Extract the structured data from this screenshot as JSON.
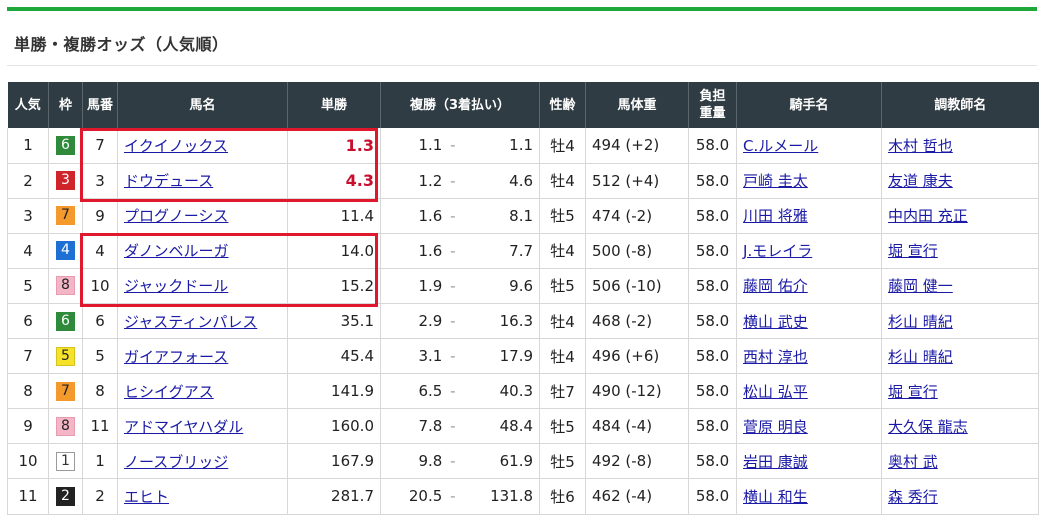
{
  "section": {
    "title": "単勝・複勝オッズ（人気順）"
  },
  "columns": {
    "pop": "人気",
    "frame": "枠",
    "num": "馬番",
    "name": "馬名",
    "win": "単勝",
    "place": "複勝（3着払い）",
    "sexage": "性齢",
    "weight": "馬体重",
    "burden_1": "負担",
    "burden_2": "重量",
    "jockey": "騎手名",
    "trainer": "調教師名"
  },
  "place_separator": "-",
  "frame_colors": {
    "1": "#ffffff",
    "2": "#222222",
    "3": "#d0242b",
    "4": "#1e6fd4",
    "5": "#f7e22a",
    "6": "#2f8a3c",
    "7": "#f49a2c",
    "8": "#f4b6c6"
  },
  "highlight_color": "#e0182d",
  "rows": [
    {
      "pop": "1",
      "frame": "6",
      "num": "7",
      "name": "イクイノックス",
      "win": "1.3",
      "place_lo": "1.1",
      "place_hi": "1.1",
      "sexage": "牡4",
      "weight": "494 (+2)",
      "burden": "58.0",
      "jockey": "C.ルメール",
      "trainer": "木村 哲也"
    },
    {
      "pop": "2",
      "frame": "3",
      "num": "3",
      "name": "ドウデュース",
      "win": "4.3",
      "place_lo": "1.2",
      "place_hi": "4.6",
      "sexage": "牡4",
      "weight": "512 (+4)",
      "burden": "58.0",
      "jockey": "戸崎 圭太",
      "trainer": "友道 康夫"
    },
    {
      "pop": "3",
      "frame": "7",
      "num": "9",
      "name": "プログノーシス",
      "win": "11.4",
      "place_lo": "1.6",
      "place_hi": "8.1",
      "sexage": "牡5",
      "weight": "474 (-2)",
      "burden": "58.0",
      "jockey": "川田 将雅",
      "trainer": "中内田 充正"
    },
    {
      "pop": "4",
      "frame": "4",
      "num": "4",
      "name": "ダノンベルーガ",
      "win": "14.0",
      "place_lo": "1.6",
      "place_hi": "7.7",
      "sexage": "牡4",
      "weight": "500 (-8)",
      "burden": "58.0",
      "jockey": "J.モレイラ",
      "trainer": "堀 宣行"
    },
    {
      "pop": "5",
      "frame": "8",
      "num": "10",
      "name": "ジャックドール",
      "win": "15.2",
      "place_lo": "1.9",
      "place_hi": "9.6",
      "sexage": "牡5",
      "weight": "506 (-10)",
      "burden": "58.0",
      "jockey": "藤岡 佑介",
      "trainer": "藤岡 健一"
    },
    {
      "pop": "6",
      "frame": "6",
      "num": "6",
      "name": "ジャスティンパレス",
      "win": "35.1",
      "place_lo": "2.9",
      "place_hi": "16.3",
      "sexage": "牡4",
      "weight": "468 (-2)",
      "burden": "58.0",
      "jockey": "横山 武史",
      "trainer": "杉山 晴紀"
    },
    {
      "pop": "7",
      "frame": "5",
      "num": "5",
      "name": "ガイアフォース",
      "win": "45.4",
      "place_lo": "3.1",
      "place_hi": "17.9",
      "sexage": "牡4",
      "weight": "496 (+6)",
      "burden": "58.0",
      "jockey": "西村 淳也",
      "trainer": "杉山 晴紀"
    },
    {
      "pop": "8",
      "frame": "7",
      "num": "8",
      "name": "ヒシイグアス",
      "win": "141.9",
      "place_lo": "6.5",
      "place_hi": "40.3",
      "sexage": "牡7",
      "weight": "490 (-12)",
      "burden": "58.0",
      "jockey": "松山 弘平",
      "trainer": "堀 宣行"
    },
    {
      "pop": "9",
      "frame": "8",
      "num": "11",
      "name": "アドマイヤハダル",
      "win": "160.0",
      "place_lo": "7.8",
      "place_hi": "48.4",
      "sexage": "牡5",
      "weight": "484 (-4)",
      "burden": "58.0",
      "jockey": "菅原 明良",
      "trainer": "大久保 龍志"
    },
    {
      "pop": "10",
      "frame": "1",
      "num": "1",
      "name": "ノースブリッジ",
      "win": "167.9",
      "place_lo": "9.8",
      "place_hi": "61.9",
      "sexage": "牡5",
      "weight": "492 (-8)",
      "burden": "58.0",
      "jockey": "岩田 康誠",
      "trainer": "奥村 武"
    },
    {
      "pop": "11",
      "frame": "2",
      "num": "2",
      "name": "エヒト",
      "win": "281.7",
      "place_lo": "20.5",
      "place_hi": "131.8",
      "sexage": "牡6",
      "weight": "462 (-4)",
      "burden": "58.0",
      "jockey": "横山 和生",
      "trainer": "森 秀行"
    }
  ]
}
